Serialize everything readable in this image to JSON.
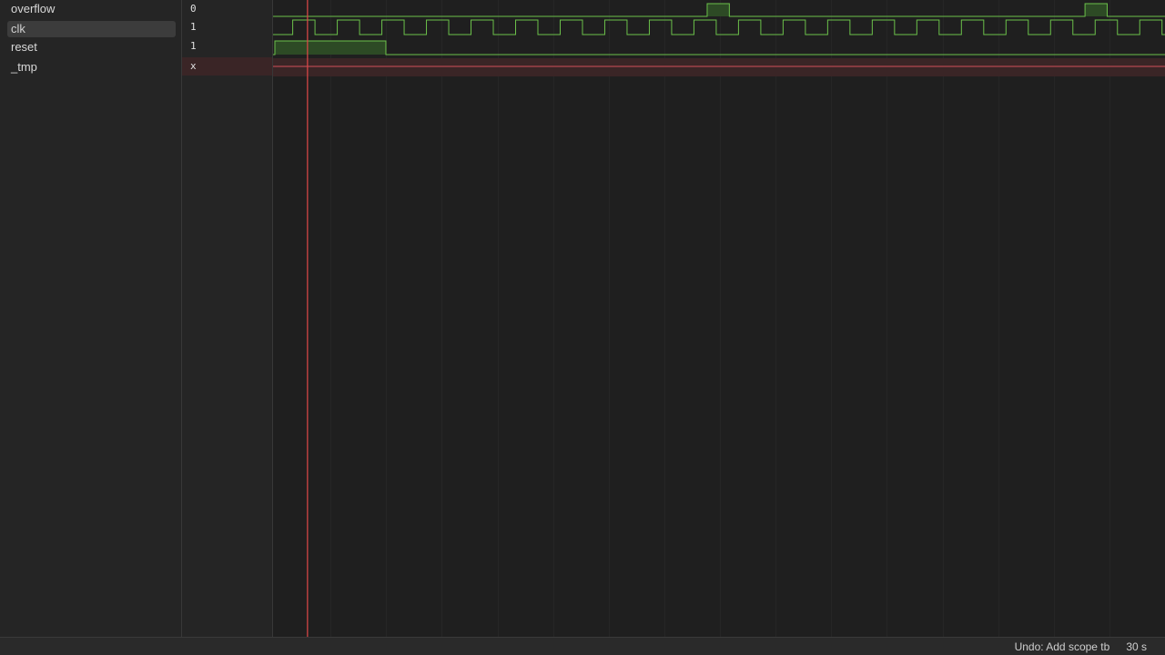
{
  "signals": [
    {
      "name": "overflow",
      "value": "0",
      "type": "pulse",
      "highs": [
        [
          11656,
          12254
        ],
        [
          21843,
          22441
        ]
      ]
    },
    {
      "name": "clk",
      "value": "1",
      "type": "clock",
      "period": 1202
    },
    {
      "name": "reset",
      "value": "1",
      "type": "pulse",
      "highs": [
        [
          0,
          2993
        ]
      ]
    },
    {
      "name": "_tmp",
      "value": "x",
      "type": "undefined"
    }
  ],
  "selected_signal": "clk",
  "timeline": {
    "start": 0,
    "end": 24000,
    "cursor_time": 880,
    "gridline_step": 1500
  },
  "colors": {
    "wave": "#6bc04a",
    "wave_fill": "#2d4a25",
    "undefined": "#d0505a",
    "undefined_band": "#3a2526",
    "cursor": "#e04848",
    "grid": "#262626"
  },
  "status": {
    "undo": "Undo: Add scope tb",
    "elapsed": "30 s"
  }
}
